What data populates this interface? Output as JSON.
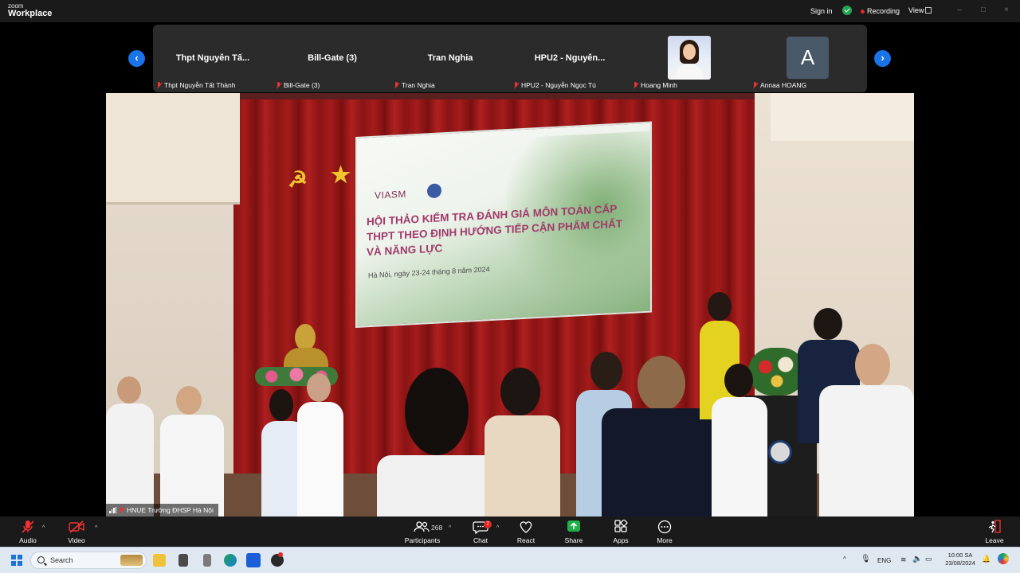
{
  "app": {
    "logo_line1": "zoom",
    "logo_line2": "Workplace",
    "sign_in": "Sign in",
    "recording": "Recording",
    "view": "View",
    "accent_color": "#1a73e8",
    "recording_color": "#e02828"
  },
  "participants": {
    "tiles": [
      {
        "name": "Thpt Nguyễn Tấ...",
        "label": "Thpt Nguyễn Tất Thành",
        "muted": true
      },
      {
        "name": "Bill-Gate (3)",
        "label": "Bill-Gate (3)",
        "muted": true
      },
      {
        "name": "Tran Nghia",
        "label": "Tran Nghia",
        "muted": true
      },
      {
        "name": "HPU2 - Nguyễn...",
        "label": "HPU2 - Nguyễn Ngọc Tú",
        "muted": true
      },
      {
        "name": "",
        "label": "Hoang Minh",
        "muted": true,
        "has_photo": true
      },
      {
        "name": "A",
        "label": "Annaa HOANG",
        "muted": true,
        "avatar_letter": "A"
      }
    ],
    "prev_icon": "chevron-left-icon",
    "next_icon": "chevron-right-icon"
  },
  "video": {
    "speaker_label": "HNUE Trường ĐHSP Hà Nội",
    "slide": {
      "org": "VIASM",
      "headline": "HỘI THẢO KIỂM TRA ĐÁNH GIÁ MÔN TOÁN CẤP THPT THEO ĐỊNH HƯỚNG TIẾP CẬN PHẨM CHẤT VÀ NĂNG LỰC",
      "dateline": "Hà Nội, ngày 23-24 tháng 8 năm 2024"
    }
  },
  "controls": {
    "audio": "Audio",
    "video": "Video",
    "participants": "Participants",
    "participants_count": "268",
    "chat": "Chat",
    "chat_badge": "7",
    "react": "React",
    "share": "Share",
    "apps": "Apps",
    "more": "More",
    "leave": "Leave"
  },
  "taskbar": {
    "search_placeholder": "Search",
    "language": "ENG",
    "time": "10:00 SA",
    "date": "23/08/2024"
  }
}
